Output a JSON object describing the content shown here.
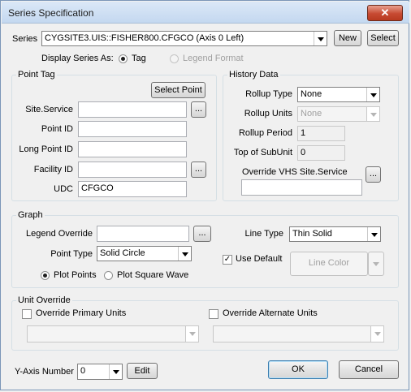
{
  "window": {
    "title": "Series Specification",
    "close_glyph": "✕"
  },
  "series": {
    "label": "Series",
    "value": "CYGSITE3.UIS::FISHER800.CFGCO (Axis 0 Left)",
    "new_label": "New",
    "select_label": "Select"
  },
  "display_as": {
    "label": "Display Series As:",
    "tag": "Tag",
    "legend_format": "Legend Format"
  },
  "point_tag": {
    "group_label": "Point Tag",
    "select_point": "Select Point",
    "site_service": "Site.Service",
    "point_id": "Point ID",
    "long_point_id": "Long Point ID",
    "facility_id": "Facility ID",
    "udc": "UDC",
    "udc_value": "CFGCO",
    "browse": "..."
  },
  "history": {
    "group_label": "History Data",
    "rollup_type": "Rollup Type",
    "rollup_type_value": "None",
    "rollup_units": "Rollup Units",
    "rollup_units_value": "None",
    "rollup_period": "Rollup Period",
    "rollup_period_value": "1",
    "top_of_subunit": "Top of SubUnit",
    "top_of_subunit_value": "0",
    "override_vhs": "Override VHS Site.Service",
    "browse": "..."
  },
  "graph": {
    "group_label": "Graph",
    "legend_override": "Legend Override",
    "browse": "...",
    "point_type": "Point Type",
    "point_type_value": "Solid Circle",
    "plot_points": "Plot Points",
    "plot_square_wave": "Plot Square Wave",
    "line_type": "Line Type",
    "line_type_value": "Thin Solid",
    "use_default": "Use Default",
    "use_default_check": "✓",
    "line_color": "Line Color"
  },
  "unit_override": {
    "group_label": "Unit Override",
    "primary": "Override Primary Units",
    "alternate": "Override Alternate Units"
  },
  "footer": {
    "y_axis_label": "Y-Axis Number",
    "y_axis_value": "0",
    "edit": "Edit",
    "ok": "OK",
    "cancel": "Cancel"
  }
}
